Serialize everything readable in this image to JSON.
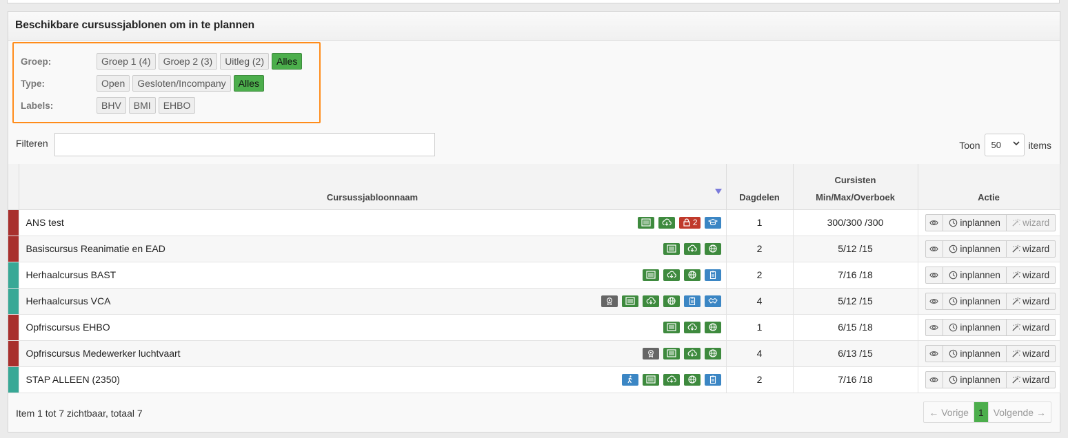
{
  "panel": {
    "title": "Beschikbare cursussjablonen om in te plannen"
  },
  "filters": {
    "groep": {
      "label": "Groep:",
      "options": [
        "Groep 1 (4)",
        "Groep 2 (3)",
        "Uitleg (2)",
        "Alles"
      ],
      "active": "Alles"
    },
    "type": {
      "label": "Type:",
      "options": [
        "Open",
        "Gesloten/Incompany",
        "Alles"
      ],
      "active": "Alles"
    },
    "labels": {
      "label": "Labels:",
      "options": [
        "BHV",
        "BMI",
        "EHBO"
      ]
    }
  },
  "search": {
    "label": "Filteren",
    "value": ""
  },
  "pagesize": {
    "prefix": "Toon",
    "value": "50",
    "suffix": "items"
  },
  "table": {
    "headers": {
      "name": "Cursussjabloonnaam",
      "dagdelen": "Dagdelen",
      "cursisten_l1": "Cursisten",
      "cursisten_l2": "Min/Max/Overboek",
      "actie": "Actie"
    },
    "rows": [
      {
        "color": "red",
        "name": "ANS test",
        "icons": [
          "list-icon:g",
          "download-cloud-icon:g",
          "lock-icon:r",
          "graduation-cap-icon:b"
        ],
        "lock_count": "2",
        "dagdelen": "1",
        "cursisten": "300/300 /300",
        "wizard_enabled": false
      },
      {
        "color": "red",
        "name": "Basiscursus Reanimatie en EAD",
        "icons": [
          "list-icon:g",
          "download-cloud-icon:g",
          "globe-icon:g"
        ],
        "dagdelen": "2",
        "cursisten": "5/12 /15",
        "wizard_enabled": true
      },
      {
        "color": "teal",
        "name": "Herhaalcursus BAST",
        "icons": [
          "list-icon:g",
          "download-cloud-icon:g",
          "globe-icon:g",
          "clipboard-icon:b"
        ],
        "dagdelen": "2",
        "cursisten": "7/16 /18",
        "wizard_enabled": true
      },
      {
        "color": "teal",
        "name": "Herhaalcursus VCA",
        "icons": [
          "certificate-icon:d",
          "list-icon:g",
          "download-cloud-icon:g",
          "globe-icon:g",
          "clipboard-icon:b",
          "handshake-icon:b"
        ],
        "dagdelen": "4",
        "cursisten": "5/12 /15",
        "wizard_enabled": true
      },
      {
        "color": "red",
        "name": "Opfriscursus EHBO",
        "icons": [
          "list-icon:g",
          "download-cloud-icon:g",
          "globe-icon:g"
        ],
        "dagdelen": "1",
        "cursisten": "6/15 /18",
        "wizard_enabled": true
      },
      {
        "color": "red",
        "name": "Opfriscursus Medewerker luchtvaart",
        "icons": [
          "certificate-icon:d",
          "list-icon:g",
          "download-cloud-icon:g",
          "globe-icon:g"
        ],
        "dagdelen": "4",
        "cursisten": "6/13 /15",
        "wizard_enabled": true
      },
      {
        "color": "teal",
        "name": "STAP ALLEEN (2350)",
        "icons": [
          "walking-icon:b",
          "list-icon:g",
          "download-cloud-icon:g",
          "globe-icon:g",
          "clipboard-icon:b"
        ],
        "dagdelen": "2",
        "cursisten": "7/16 /18",
        "wizard_enabled": true
      }
    ],
    "actions": {
      "view": "eye-icon",
      "plan_label": "inplannen",
      "wizard_label": "wizard"
    }
  },
  "footer": {
    "summary": "Item 1 tot 7 zichtbaar, totaal 7",
    "prev": "← Vorige",
    "page": "1",
    "next": "Volgende →"
  },
  "colors": {
    "stripe_red": "#a8302d",
    "stripe_teal": "#38a896",
    "active_green": "#4cae4c",
    "highlight_orange": "#ff8c1a"
  }
}
